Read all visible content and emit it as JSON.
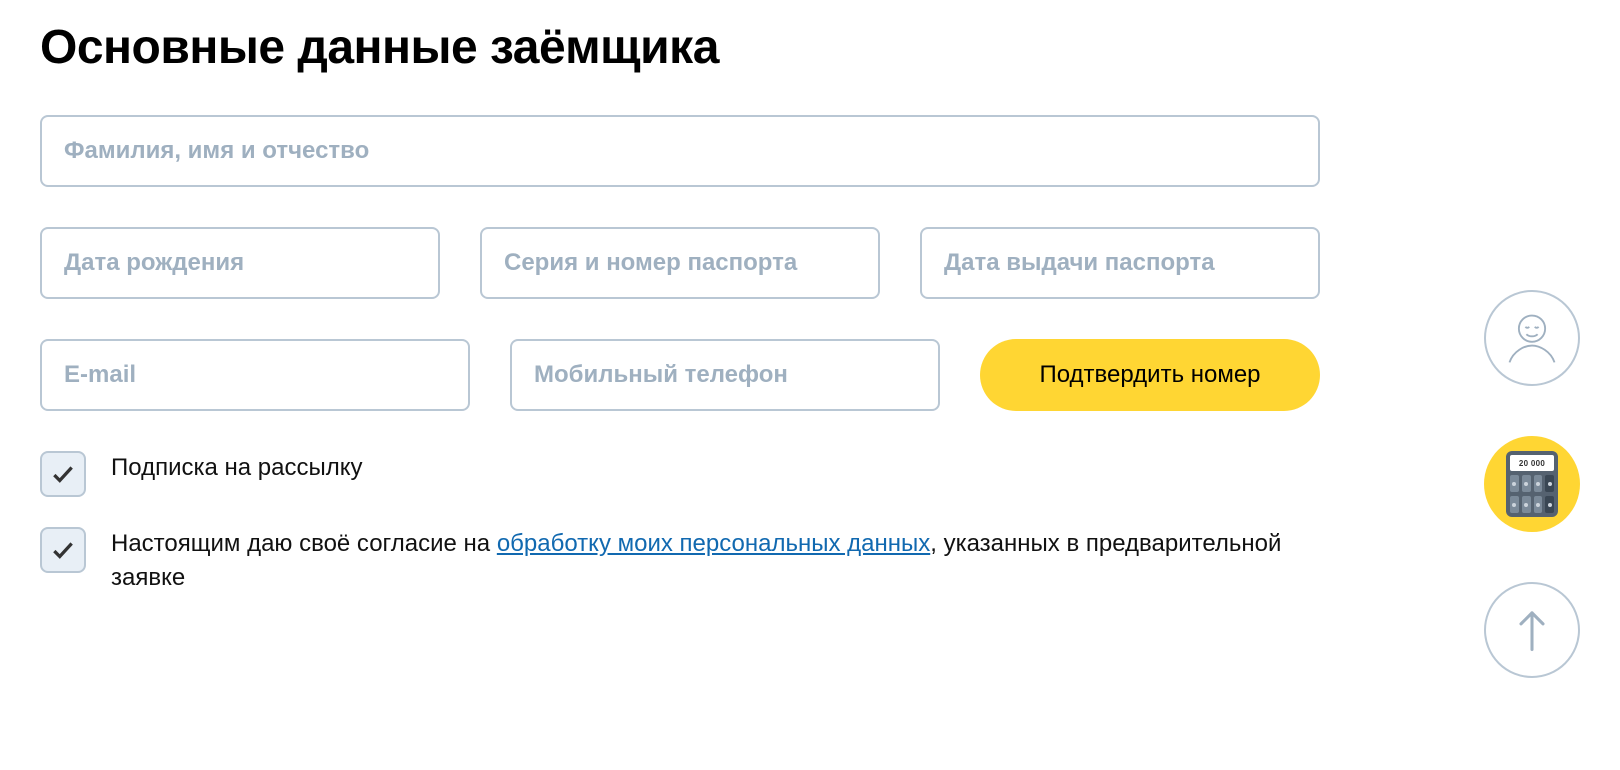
{
  "heading": "Основные данные заёмщика",
  "fields": {
    "fullname_placeholder": "Фамилия, имя и отчество",
    "birthdate_placeholder": "Дата рождения",
    "passport_placeholder": "Серия и номер паспорта",
    "passport_issue_placeholder": "Дата выдачи паспорта",
    "email_placeholder": "E-mail",
    "phone_placeholder": "Мобильный телефон"
  },
  "buttons": {
    "confirm_phone": "Подтвердить номер"
  },
  "checks": {
    "subscribe_label": "Подписка на рассылку",
    "consent_prefix": "Настоящим даю своё согласие на ",
    "consent_link": "обработку моих персональных данных",
    "consent_suffix": ", указанных в предварительной заявке"
  },
  "float": {
    "calc_display": "20 000"
  }
}
